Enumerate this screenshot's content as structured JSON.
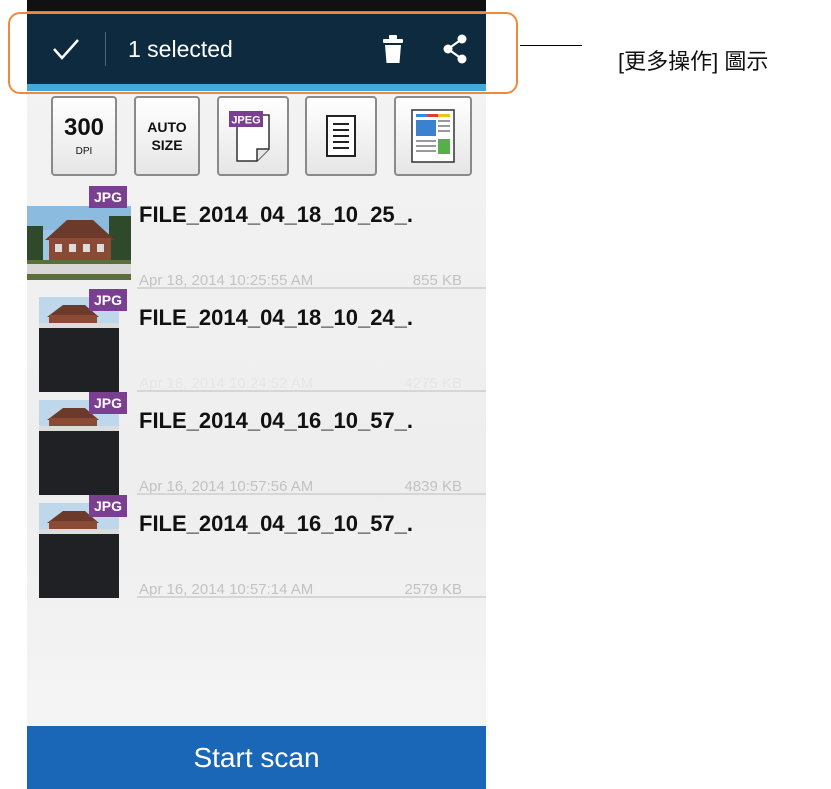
{
  "actionbar": {
    "selected_text": "1 selected",
    "confirm_icon": "check-icon",
    "delete_icon": "trash-icon",
    "share_icon": "share-icon"
  },
  "callout": {
    "label": "[更多操作] 圖示"
  },
  "toolbar": {
    "dpi_value": "300",
    "dpi_unit": "DPI",
    "auto_line1": "AUTO",
    "auto_line2": "SIZE",
    "jpeg_label": "JPEG"
  },
  "files": [
    {
      "badge": "JPG",
      "name": "FILE_2014_04_18_10_25_.",
      "date": "Apr 18, 2014 10:25:55 AM",
      "size": "855 KB"
    },
    {
      "badge": "JPG",
      "name": "FILE_2014_04_18_10_24_.",
      "date": "Apr 18, 2014 10:24:52 AM",
      "size": "4275 KB"
    },
    {
      "badge": "JPG",
      "name": "FILE_2014_04_16_10_57_.",
      "date": "Apr 16, 2014 10:57:56 AM",
      "size": "4839 KB"
    },
    {
      "badge": "JPG",
      "name": "FILE_2014_04_16_10_57_.",
      "date": "Apr 16, 2014 10:57:14 AM",
      "size": "2579 KB"
    }
  ],
  "scan_button": {
    "label": "Start scan"
  },
  "colors": {
    "actionbar_bg": "#0d2a3f",
    "accent_blue": "#1a66b7",
    "badge_purple": "#7b3f91",
    "callout_orange": "#ef8a3c"
  }
}
